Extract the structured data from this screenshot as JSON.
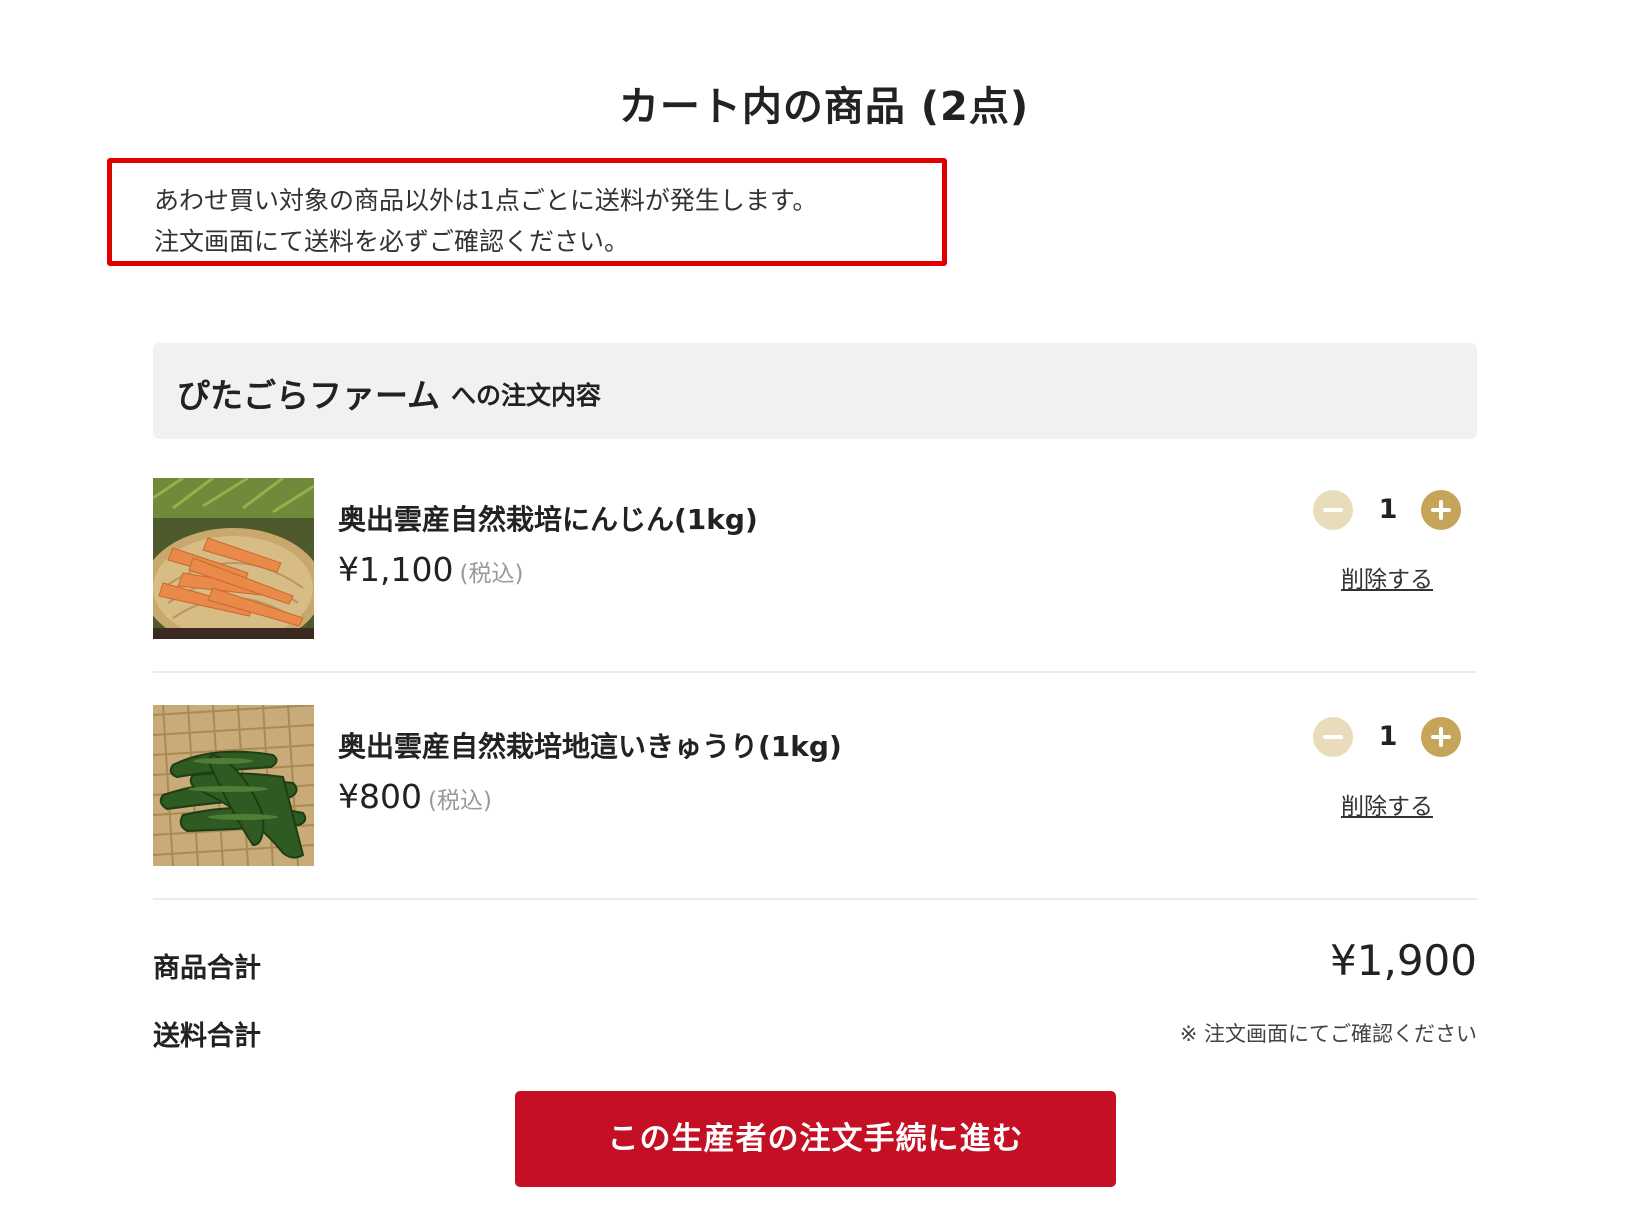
{
  "page": {
    "title": "カート内の商品 (2点)"
  },
  "notice": {
    "line1": "あわせ買い対象の商品以外は1点ごとに送料が発生します。",
    "line2": "注文画面にて送料を必ずご確認ください。",
    "border_color": "#e00000"
  },
  "producer": {
    "name": "ぴたごらファーム",
    "suffix": "への注文内容"
  },
  "items": [
    {
      "name": "奥出雲産自然栽培にんじん(1kg)",
      "price": "¥1,100",
      "tax_note": "(税込)",
      "quantity": "1",
      "delete_label": "削除する",
      "image": "carrot-photo"
    },
    {
      "name": "奥出雲産自然栽培地這いきゅうり(1kg)",
      "price": "¥800",
      "tax_note": "(税込)",
      "quantity": "1",
      "delete_label": "削除する",
      "image": "cucumber-photo"
    }
  ],
  "summary": {
    "subtotal_label": "商品合計",
    "subtotal_value": "¥1,900",
    "shipping_label": "送料合計",
    "shipping_note": "※ 注文画面にてご確認ください"
  },
  "checkout": {
    "label": "この生産者の注文手続に進む",
    "color": "#c50f24"
  },
  "colors": {
    "qty_minus": "#e8dcbb",
    "qty_plus": "#c6a55a",
    "header_bg": "#f1f1f1"
  }
}
